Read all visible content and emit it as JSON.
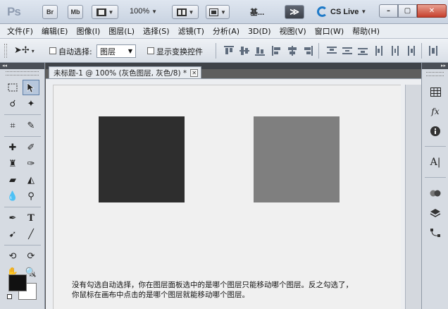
{
  "appbar": {
    "logo": "Ps",
    "bridge_btn": "Br",
    "minibridge_btn": "Mb",
    "zoom_value": "100%",
    "workspace_label": "基...",
    "more_btn": "≫",
    "cslive_label": "CS Live",
    "window_buttons": [
      "–",
      "▢",
      "✕"
    ]
  },
  "menu": {
    "items": [
      "文件(F)",
      "编辑(E)",
      "图像(I)",
      "图层(L)",
      "选择(S)",
      "滤镜(T)",
      "分析(A)",
      "3D(D)",
      "视图(V)",
      "窗口(W)",
      "帮助(H)"
    ]
  },
  "options": {
    "tool_icon": "move-tool-icon",
    "auto_select_label": "自动选择:",
    "auto_select_checked": false,
    "auto_select_target": "图层",
    "show_transform_label": "显示变换控件",
    "show_transform_checked": false
  },
  "toolpanel": {
    "collapse_glyph": "◂◂",
    "tools": [
      "marquee-tool-icon",
      "move-tool-icon",
      "lasso-tool-icon",
      "magic-wand-tool-icon",
      "crop-tool-icon",
      "eyedropper-tool-icon",
      "healing-brush-tool-icon",
      "brush-tool-icon",
      "clone-stamp-tool-icon",
      "history-brush-tool-icon",
      "eraser-tool-icon",
      "paint-bucket-tool-icon",
      "blur-tool-icon",
      "dodge-tool-icon",
      "pen-tool-icon",
      "type-tool-icon",
      "path-selection-tool-icon",
      "line-tool-icon",
      "3d-rotate-tool-icon",
      "3d-orbit-tool-icon",
      "hand-tool-icon",
      "zoom-tool-icon"
    ],
    "foreground_color": "#111111",
    "background_color": "#ffffff"
  },
  "document": {
    "tab_title": "未标题-1 @ 100% (灰色图层, 灰色/8) *",
    "dark_square_color": "#2e2e2e",
    "gray_square_color": "#7f7f7f",
    "caption_line1": "没有勾选自动选择，你在图层面板选中的是哪个图层只能移动哪个图层。反之勾选了，",
    "caption_line2": "你鼠标在画布中点击的是哪个图层就能移动哪个图层。"
  },
  "rightdock": {
    "collapse_glyph": "▸▸",
    "icons": [
      "histogram-icon",
      "fx-icon",
      "info-icon",
      "character-icon",
      "channels-icon",
      "layers-icon",
      "paths-icon"
    ]
  }
}
